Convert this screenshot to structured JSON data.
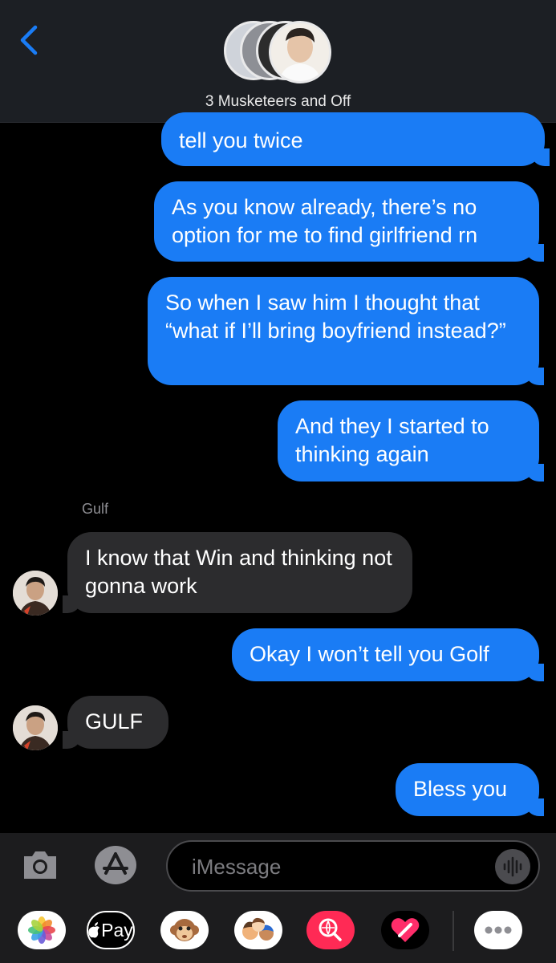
{
  "header": {
    "back_icon": "chevron-left-icon",
    "group_name": "3 Musketeers and Off"
  },
  "messages": [
    {
      "direction": "outgoing",
      "text": "tell you twice"
    },
    {
      "direction": "outgoing",
      "text": "As you know already, there’s no option for me to find girlfriend rn"
    },
    {
      "direction": "outgoing",
      "text": "So when I saw him I thought that “what if I’ll bring boyfriend instead?”"
    },
    {
      "direction": "outgoing",
      "text": "And they I started to thinking again"
    },
    {
      "direction": "incoming",
      "sender": "Gulf",
      "text": "I know that Win and thinking not gonna work"
    },
    {
      "direction": "outgoing",
      "text": "Okay I won’t tell you Golf"
    },
    {
      "direction": "incoming",
      "text": "GULF"
    },
    {
      "direction": "outgoing",
      "text": "Bless you"
    }
  ],
  "composer": {
    "placeholder": "iMessage",
    "camera_icon": "camera-icon",
    "appstore_icon": "appstore-icon",
    "audio_icon": "audio-waveform-icon"
  },
  "app_drawer": {
    "apple_pay_label": "Pay",
    "apps": [
      "photos-icon",
      "apple-pay-icon",
      "monkey-emoji-icon",
      "memoji-icon",
      "web-search-icon",
      "digital-touch-icon",
      "more-icon"
    ]
  },
  "colors": {
    "outgoing": "#1a7cf5",
    "incoming": "#2c2c2e",
    "accent": "#1a7cf5"
  }
}
